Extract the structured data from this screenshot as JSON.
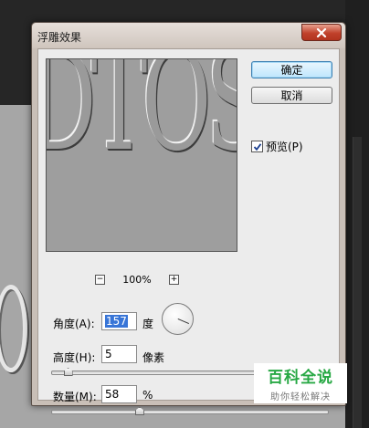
{
  "dialog": {
    "title": "浮雕效果",
    "close_icon": "close-icon",
    "ok_label": "确定",
    "cancel_label": "取消",
    "preview_label": "预览(P)",
    "preview_checked": true
  },
  "preview": {
    "image_text": "DTOSI",
    "zoom_out": "−",
    "zoom_level": "100%",
    "zoom_in": "+"
  },
  "controls": {
    "angle": {
      "label": "角度(A):",
      "value": "157",
      "unit": "度"
    },
    "height": {
      "label": "高度(H):",
      "value": "5",
      "unit": "像素",
      "slider_fraction": 0.04
    },
    "amount": {
      "label": "数量(M):",
      "value": "58",
      "unit": "%",
      "slider_fraction": 0.31
    }
  },
  "watermark": {
    "main": "百科全说",
    "sub": "助你轻松解决"
  },
  "colors": {
    "default_button": "#bee6fd",
    "watermark_green": "#27a844",
    "close_button": "#c0412b"
  }
}
